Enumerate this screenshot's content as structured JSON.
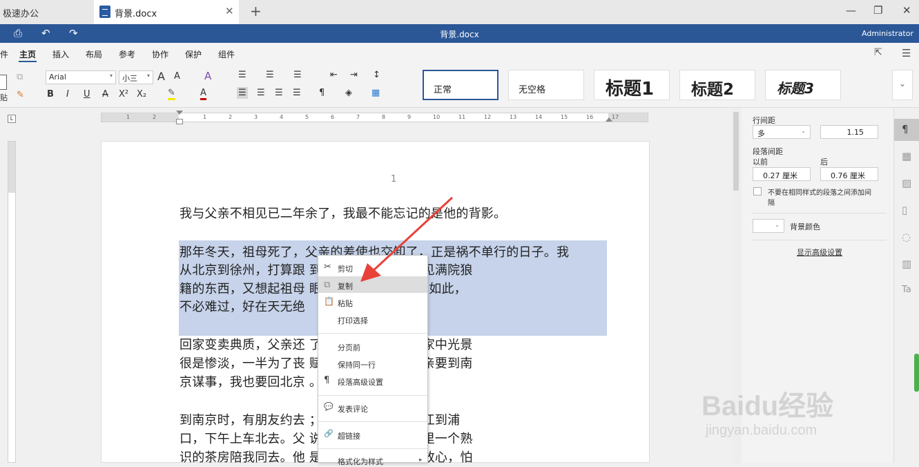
{
  "tabs": {
    "app": "极速办公",
    "doc": "背景.docx",
    "close": "✕",
    "new": "+"
  },
  "window": {
    "min": "—",
    "max": "❐",
    "close": "✕"
  },
  "header": {
    "title": "背景.docx",
    "user": "Administrator"
  },
  "menu": {
    "items": [
      "件",
      "主页",
      "插入",
      "布局",
      "参考",
      "协作",
      "保护",
      "组件"
    ]
  },
  "ribbon": {
    "font": "Arial",
    "size": "小三",
    "grow": "A",
    "shrink": "A",
    "bold": "B",
    "italic": "I",
    "underline": "U",
    "strike": "A",
    "sup": "X²",
    "sub": "X₂",
    "paste_label": "贴"
  },
  "styles": [
    "正常",
    "无空格",
    "标题1",
    "标题2",
    "标题3"
  ],
  "ruler": {
    "labels": [
      "1",
      "2",
      "1",
      "2",
      "3",
      "4",
      "5",
      "6",
      "7",
      "8",
      "9",
      "10",
      "11",
      "12",
      "13",
      "14",
      "15",
      "16",
      "17"
    ]
  },
  "page": {
    "number": "1",
    "lines": [
      "我与父亲不相见已二年余了，我最不能忘记的是他的背影。",
      "那年冬天，祖母死了，父亲的差使也交卸了，正是祸不单行的日子。我",
      "从北京到徐州，打算跟                        到徐州见着父亲，看见满院狼",
      "籍的东西，又想起祖母                        眼泪。父亲说：“事已如此，",
      "不必难过，好在天无绝",
      "回家变卖典质，父亲还                        了丧事。这些日子，家中光景",
      "很是惨淡，一半为了丧                        赋闲。丧事完毕，父亲要到南",
      "京谋事，我也要回北京                        。",
      "到南京时，有朋友约去                        ；第二日上午便须渡江到浦",
      "口，下午上车北去。父                        说定不送我，叫旅馆里一个熟",
      "识的茶房陪我同去。他                        是仔细。但他终于不放心，怕"
    ]
  },
  "context_menu": {
    "items": [
      {
        "label": "剪切",
        "icon": "✂"
      },
      {
        "label": "复制",
        "icon": "⧉"
      },
      {
        "label": "粘贴",
        "icon": "📋"
      },
      {
        "label": "打印选择",
        "icon": ""
      },
      {
        "label": "分页前",
        "icon": ""
      },
      {
        "label": "保持同一行",
        "icon": ""
      },
      {
        "label": "段落高级设置",
        "icon": "¶"
      },
      {
        "label": "发表评论",
        "icon": "💬"
      },
      {
        "label": "超链接",
        "icon": "🔗"
      },
      {
        "label": "格式化为样式",
        "icon": ""
      }
    ]
  },
  "panel": {
    "line_spacing_label": "行间距",
    "line_spacing_mode": "多",
    "line_spacing_value": "1.15",
    "para_spacing_label": "段落间距",
    "before_label": "以前",
    "after_label": "后",
    "before_value": "0.27 厘米",
    "after_value": "0.76 厘米",
    "no_space_label": "不要在相同样式的段落之间添加间",
    "no_space_label2": "隔",
    "bg_color_label": "背景颜色",
    "advanced_link": "显示高级设置"
  },
  "watermark": {
    "brand": "Baidu经验",
    "url": "jingyan.baidu.com"
  },
  "colors": {
    "accent": "#2b5797",
    "selection": "#c6d3ea",
    "arrow": "#e8413a"
  }
}
